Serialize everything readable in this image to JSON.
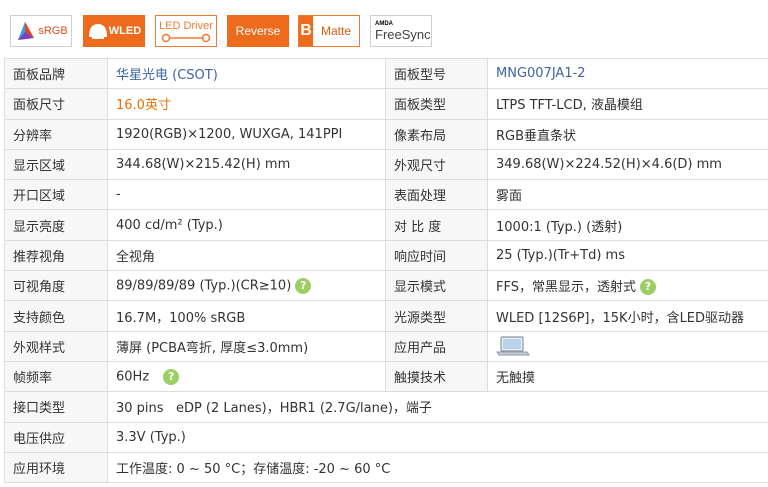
{
  "badges": {
    "srgb": "sRGB",
    "wled": "WLED",
    "led_driver": "LED Driver",
    "reverse": "Reverse",
    "matte": "Matte",
    "matte_mark": "B",
    "amd": "AMDA",
    "freesync": "FreeSync"
  },
  "colors": {
    "link": "#3e63a8",
    "highlight": "#e8710a",
    "badge_orange": "#ed6b1c",
    "help": "#9ccf63"
  },
  "rows": [
    {
      "l1": "面板品牌",
      "v1": "华星光电 (CSOT)",
      "l2": "面板型号",
      "v2": "MNG007JA1-2"
    },
    {
      "l1": "面板尺寸",
      "v1": "16.0英寸",
      "l2": "面板类型",
      "v2": "LTPS TFT-LCD, 液晶模组"
    },
    {
      "l1": "分辨率",
      "v1": "1920(RGB)×1200, WUXGA, 141PPI",
      "l2": "像素布局",
      "v2": "RGB垂直条状"
    },
    {
      "l1": "显示区域",
      "v1": "344.68(W)×215.42(H) mm",
      "l2": "外观尺寸",
      "v2": "349.68(W)×224.52(H)×4.6(D) mm"
    },
    {
      "l1": "开口区域",
      "v1": "-",
      "l2": "表面处理",
      "v2": "雾面"
    },
    {
      "l1": "显示亮度",
      "v1": "400 cd/m² (Typ.)",
      "l2": "对 比 度",
      "v2": "1000:1 (Typ.) (透射)"
    },
    {
      "l1": "推荐视角",
      "v1": "全视角",
      "l2": "响应时间",
      "v2": "25 (Typ.)(Tr+Td) ms"
    },
    {
      "l1": "可视角度",
      "v1": "89/89/89/89 (Typ.)(CR≥10)",
      "l2": "显示模式",
      "v2": "FFS，常黑显示，透射式"
    },
    {
      "l1": "支持颜色",
      "v1": "16.7M，100% sRGB",
      "l2": "光源类型",
      "v2": "WLED [12S6P]，15K小时，含LED驱动器"
    },
    {
      "l1": "外观样式",
      "v1": "薄屏 (PCBA弯折, 厚度≤3.0mm)",
      "l2": "应用产品",
      "v2": ""
    },
    {
      "l1": "帧频率",
      "v1": "60Hz",
      "l2": "触摸技术",
      "v2": "无触摸"
    },
    {
      "l1": "接口类型",
      "v1": "30 pins   eDP (2 Lanes)，HBR1 (2.7G/lane)，端子"
    },
    {
      "l1": "电压供应",
      "v1": "3.3V (Typ.)"
    },
    {
      "l1": "应用环境",
      "v1": "工作温度: 0 ~ 50 °C；存储温度: -20 ~ 60 °C"
    }
  ],
  "help_icon": "?"
}
